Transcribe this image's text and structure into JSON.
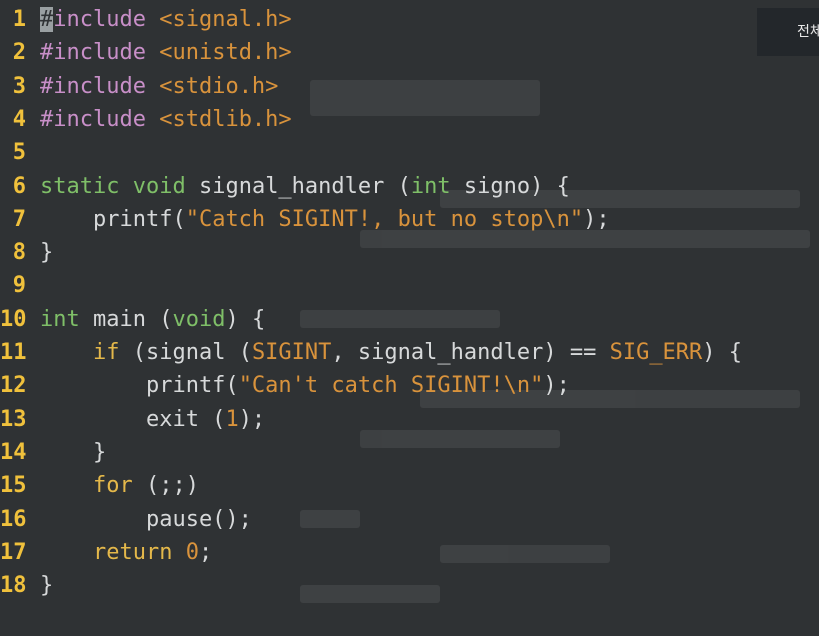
{
  "corner_button": {
    "label": "전체"
  },
  "lines": [
    {
      "n": "1",
      "parts": [
        [
          "cursor",
          "#"
        ],
        [
          "pp",
          "include"
        ],
        [
          "t",
          " "
        ],
        [
          "str",
          "<signal.h>"
        ]
      ]
    },
    {
      "n": "2",
      "parts": [
        [
          "pp",
          "#include"
        ],
        [
          "t",
          " "
        ],
        [
          "str",
          "<unistd.h>"
        ]
      ]
    },
    {
      "n": "3",
      "parts": [
        [
          "pp",
          "#include"
        ],
        [
          "t",
          " "
        ],
        [
          "str",
          "<stdio.h>"
        ]
      ]
    },
    {
      "n": "4",
      "parts": [
        [
          "pp",
          "#include"
        ],
        [
          "t",
          " "
        ],
        [
          "str",
          "<stdlib.h>"
        ]
      ]
    },
    {
      "n": "5",
      "parts": []
    },
    {
      "n": "6",
      "parts": [
        [
          "kw",
          "static"
        ],
        [
          "t",
          " "
        ],
        [
          "kw",
          "void"
        ],
        [
          "t",
          " signal_handler ("
        ],
        [
          "kw",
          "int"
        ],
        [
          "t",
          " signo) {"
        ]
      ]
    },
    {
      "n": "7",
      "parts": [
        [
          "t",
          "    printf("
        ],
        [
          "str",
          "\"Catch SIGINT!, but no stop"
        ],
        [
          "esc",
          "\\n"
        ],
        [
          "str",
          "\""
        ],
        [
          "t",
          ");"
        ]
      ]
    },
    {
      "n": "8",
      "parts": [
        [
          "t",
          "}"
        ]
      ]
    },
    {
      "n": "9",
      "parts": []
    },
    {
      "n": "10",
      "parts": [
        [
          "kw",
          "int"
        ],
        [
          "t",
          " main ("
        ],
        [
          "kw",
          "void"
        ],
        [
          "t",
          ") {"
        ]
      ]
    },
    {
      "n": "11",
      "parts": [
        [
          "t",
          "    "
        ],
        [
          "ctl",
          "if"
        ],
        [
          "t",
          " (signal ("
        ],
        [
          "const",
          "SIGINT"
        ],
        [
          "t",
          ", signal_handler) == "
        ],
        [
          "const",
          "SIG_ERR"
        ],
        [
          "t",
          ") {"
        ]
      ]
    },
    {
      "n": "12",
      "parts": [
        [
          "t",
          "        printf("
        ],
        [
          "str",
          "\"Can't catch SIGINT!"
        ],
        [
          "esc",
          "\\n"
        ],
        [
          "str",
          "\""
        ],
        [
          "t",
          ");"
        ]
      ]
    },
    {
      "n": "13",
      "parts": [
        [
          "t",
          "        exit ("
        ],
        [
          "num",
          "1"
        ],
        [
          "t",
          ");"
        ]
      ]
    },
    {
      "n": "14",
      "parts": [
        [
          "t",
          "    }"
        ]
      ]
    },
    {
      "n": "15",
      "parts": [
        [
          "t",
          "    "
        ],
        [
          "ctl",
          "for"
        ],
        [
          "t",
          " (;;)"
        ]
      ]
    },
    {
      "n": "16",
      "parts": [
        [
          "t",
          "        pause();"
        ]
      ]
    },
    {
      "n": "17",
      "parts": [
        [
          "t",
          "    "
        ],
        [
          "ctl",
          "return"
        ],
        [
          "t",
          " "
        ],
        [
          "num",
          "0"
        ],
        [
          "t",
          ";"
        ]
      ]
    },
    {
      "n": "18",
      "parts": [
        [
          "t",
          "}"
        ]
      ]
    }
  ]
}
